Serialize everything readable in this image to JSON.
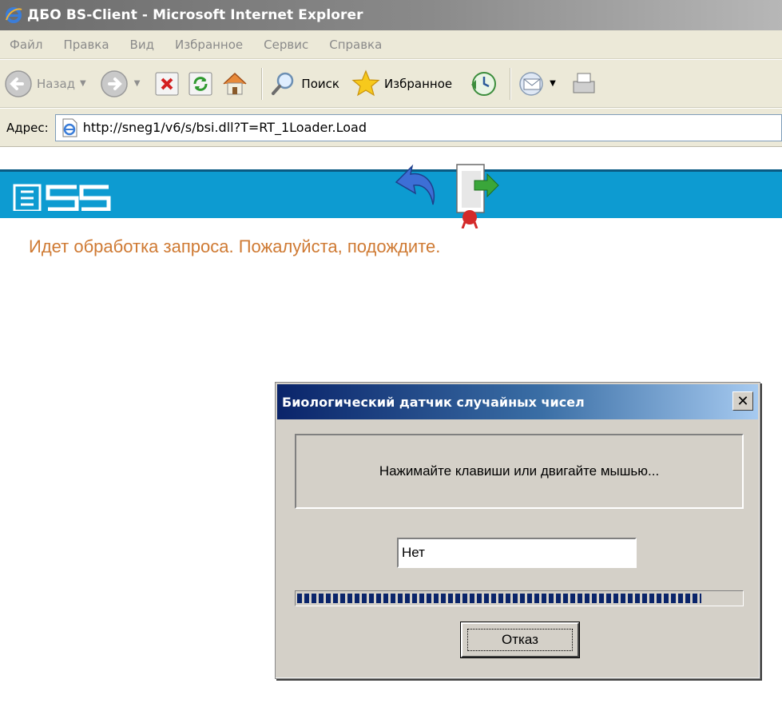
{
  "window": {
    "title": "ДБО BS-Client - Microsoft Internet Explorer"
  },
  "menu": [
    "Файл",
    "Правка",
    "Вид",
    "Избранное",
    "Сервис",
    "Справка"
  ],
  "toolbar": {
    "back_label": "Назад",
    "search_label": "Поиск",
    "favorites_label": "Избранное"
  },
  "address": {
    "label": "Адрес:",
    "url": "http://sneg1/v6/s/bsi.dll?T=RT_1Loader.Load"
  },
  "page": {
    "status_message": "Идет обработка запроса. Пожалуйста, подождите."
  },
  "dialog": {
    "title": "Биологический датчик случайных чисел",
    "close_symbol": "✕",
    "prompt": "Нажимайте клавиши или двигайте мышью...",
    "input_value": "Нет",
    "progress_fraction": 0.91,
    "cancel_label": "Отказ"
  },
  "colors": {
    "banner_blue": "#0d9bd1",
    "status_orange": "#cf7a33",
    "dialog_title_start": "#0a246a",
    "progress_block": "#0a246a"
  }
}
